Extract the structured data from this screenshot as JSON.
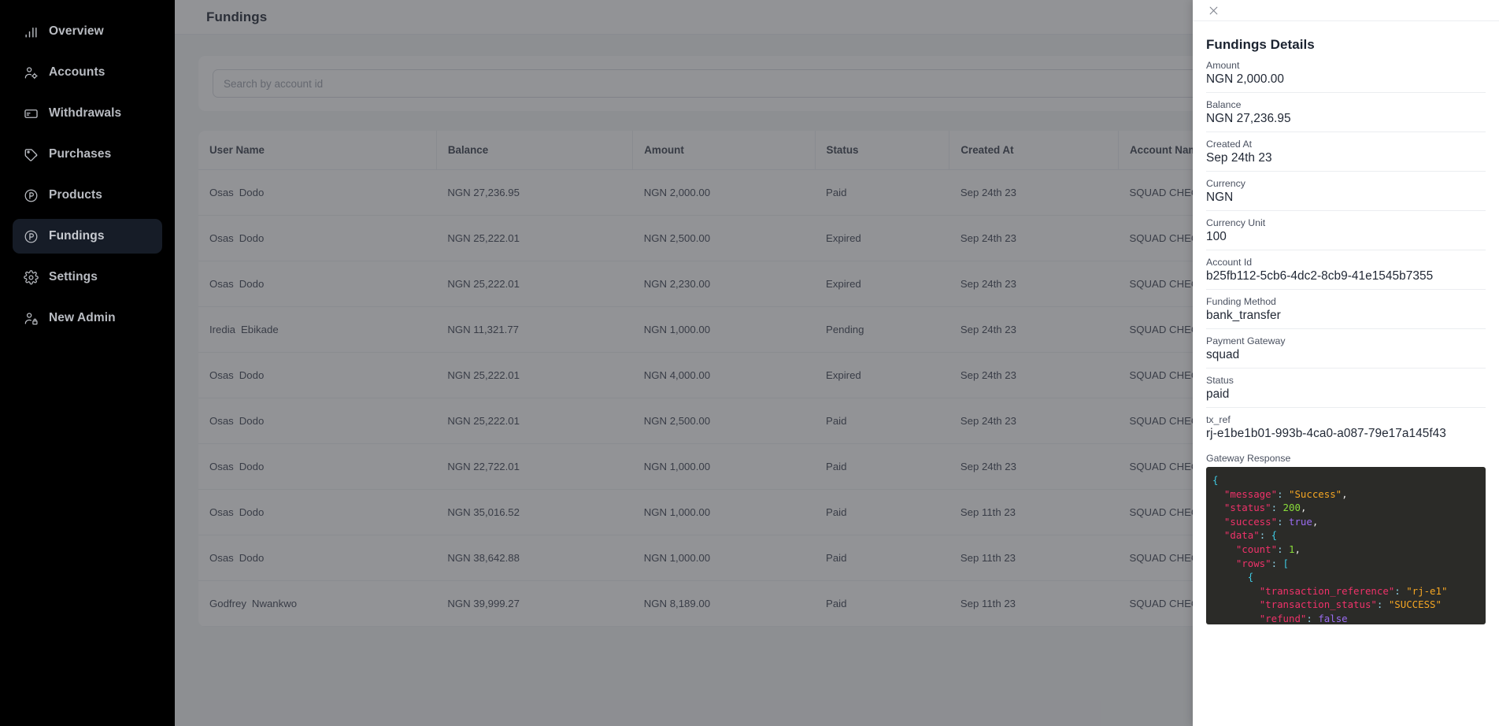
{
  "sidebar": {
    "items": [
      {
        "label": "Overview",
        "icon": "bar-chart-icon",
        "active": false
      },
      {
        "label": "Accounts",
        "icon": "user-cog-icon",
        "active": false
      },
      {
        "label": "Withdrawals",
        "icon": "card-icon",
        "active": false
      },
      {
        "label": "Purchases",
        "icon": "tag-icon",
        "active": false
      },
      {
        "label": "Products",
        "icon": "circle-p-icon",
        "active": false
      },
      {
        "label": "Fundings",
        "icon": "circle-p-icon",
        "active": true
      },
      {
        "label": "Settings",
        "icon": "gear-icon",
        "active": false
      },
      {
        "label": "New Admin",
        "icon": "user-lock-icon",
        "active": false
      }
    ]
  },
  "header": {
    "title": "Fundings"
  },
  "search": {
    "placeholder": "Search by account id",
    "value": ""
  },
  "table": {
    "columns": [
      "User Name",
      "Balance",
      "Amount",
      "Status",
      "Created At",
      "Account Name"
    ],
    "rows": [
      {
        "first": "Osas",
        "last": "Dodo",
        "balance": "NGN 27,236.95",
        "amount": "NGN 2,000.00",
        "status": "Paid",
        "created": "Sep 24th 23",
        "account": "SQUAD CHECKOUT"
      },
      {
        "first": "Osas",
        "last": "Dodo",
        "balance": "NGN 25,222.01",
        "amount": "NGN 2,500.00",
        "status": "Expired",
        "created": "Sep 24th 23",
        "account": "SQUAD CHECKOUT"
      },
      {
        "first": "Osas",
        "last": "Dodo",
        "balance": "NGN 25,222.01",
        "amount": "NGN 2,230.00",
        "status": "Expired",
        "created": "Sep 24th 23",
        "account": "SQUAD CHECKOUT"
      },
      {
        "first": "Iredia",
        "last": "Ebikade",
        "balance": "NGN 11,321.77",
        "amount": "NGN 1,000.00",
        "status": "Pending",
        "created": "Sep 24th 23",
        "account": "SQUAD CHECKOUT"
      },
      {
        "first": "Osas",
        "last": "Dodo",
        "balance": "NGN 25,222.01",
        "amount": "NGN 4,000.00",
        "status": "Expired",
        "created": "Sep 24th 23",
        "account": "SQUAD CHECKOUT"
      },
      {
        "first": "Osas",
        "last": "Dodo",
        "balance": "NGN 25,222.01",
        "amount": "NGN 2,500.00",
        "status": "Paid",
        "created": "Sep 24th 23",
        "account": "SQUAD CHECKOUT"
      },
      {
        "first": "Osas",
        "last": "Dodo",
        "balance": "NGN 22,722.01",
        "amount": "NGN 1,000.00",
        "status": "Paid",
        "created": "Sep 24th 23",
        "account": "SQUAD CHECKOUT"
      },
      {
        "first": "Osas",
        "last": "Dodo",
        "balance": "NGN 35,016.52",
        "amount": "NGN 1,000.00",
        "status": "Paid",
        "created": "Sep 11th 23",
        "account": "SQUAD CHECKOUT"
      },
      {
        "first": "Osas",
        "last": "Dodo",
        "balance": "NGN 38,642.88",
        "amount": "NGN 1,000.00",
        "status": "Paid",
        "created": "Sep 11th 23",
        "account": "SQUAD CHECKOUT"
      },
      {
        "first": "Godfrey",
        "last": "Nwankwo",
        "balance": "NGN 39,999.27",
        "amount": "NGN 8,189.00",
        "status": "Paid",
        "created": "Sep 11th 23",
        "account": "SQUAD CHECKOUT"
      }
    ]
  },
  "panel": {
    "close_icon": "close-icon",
    "title": "Fundings Details",
    "fields": [
      {
        "label": "Amount",
        "value": "NGN 2,000.00"
      },
      {
        "label": "Balance",
        "value": "NGN 27,236.95"
      },
      {
        "label": "Created At",
        "value": "Sep 24th 23"
      },
      {
        "label": "Currency",
        "value": "NGN"
      },
      {
        "label": "Currency Unit",
        "value": "100"
      },
      {
        "label": "Account Id",
        "value": "b25fb112-5cb6-4dc2-8cb9-41e1545b7355"
      },
      {
        "label": "Funding Method",
        "value": "bank_transfer"
      },
      {
        "label": "Payment Gateway",
        "value": "squad"
      },
      {
        "label": "Status",
        "value": "paid"
      },
      {
        "label": "tx_ref",
        "value": "rj-e1be1b01-993b-4ca0-a087-79e17a145f43"
      }
    ],
    "gateway_response_label": "Gateway Response",
    "gateway_response": {
      "message": "Success",
      "status": 200,
      "success": true,
      "data": {
        "count": 1,
        "rows": [
          {
            "transaction_reference": "rj-e1",
            "transaction_status": "SUCCESS",
            "refund": false
          }
        ]
      }
    }
  },
  "colors": {
    "sidebar_bg": "#000000",
    "sidebar_active": "#161c27",
    "accent_paid": "#1f9d55",
    "code_bg": "#2b2b28",
    "page_bg": "#f4f5f7"
  }
}
